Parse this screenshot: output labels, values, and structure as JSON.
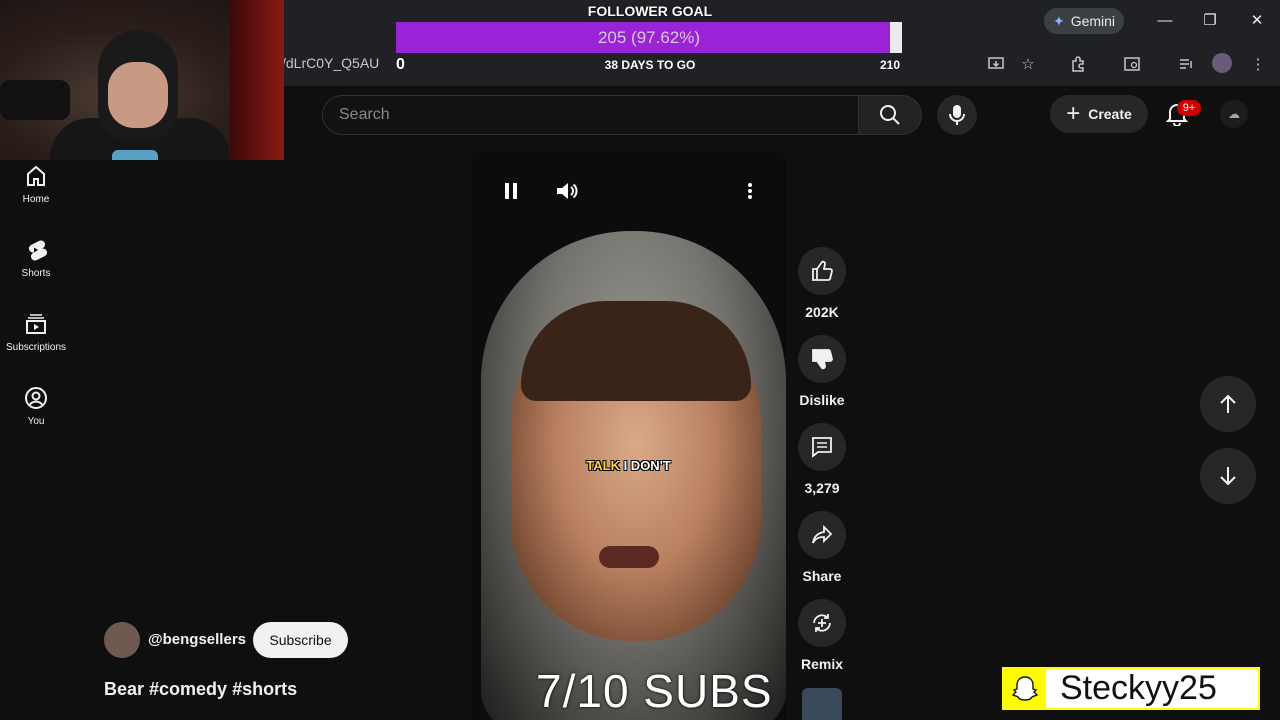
{
  "browser": {
    "url_fragment": "/dLrC0Y_Q5AU",
    "gemini_label": "Gemini"
  },
  "follower_goal": {
    "title": "FOLLOWER GOAL",
    "value_text": "205 (97.62%)",
    "progress_fraction": 0.9762,
    "min_label": "0",
    "days_label": "38 DAYS TO GO",
    "max_label": "210"
  },
  "header": {
    "search_placeholder": "Search",
    "create_label": "Create",
    "notification_badge": "9+"
  },
  "sidebar": {
    "items": [
      {
        "label": "Home",
        "icon": "home-icon"
      },
      {
        "label": "Shorts",
        "icon": "shorts-icon"
      },
      {
        "label": "Subscriptions",
        "icon": "subscriptions-icon"
      },
      {
        "label": "You",
        "icon": "you-icon"
      }
    ]
  },
  "video": {
    "caption_highlight": "TALK",
    "caption_rest": " I DON'T",
    "overlay_text": "7/10 SUBS"
  },
  "actions": {
    "likes": "202K",
    "dislike_label": "Dislike",
    "comments": "3,279",
    "share_label": "Share",
    "remix_label": "Remix"
  },
  "channel": {
    "handle": "@bengsellers",
    "subscribe_label": "Subscribe",
    "title": "Bear #comedy #shorts"
  },
  "snapchat": {
    "username": "Steckyy25"
  },
  "colors": {
    "goal_fill": "#9a23d6",
    "page_bg": "#0f0f0f",
    "badge": "#cc0000",
    "snap_yellow": "#fffc00"
  }
}
